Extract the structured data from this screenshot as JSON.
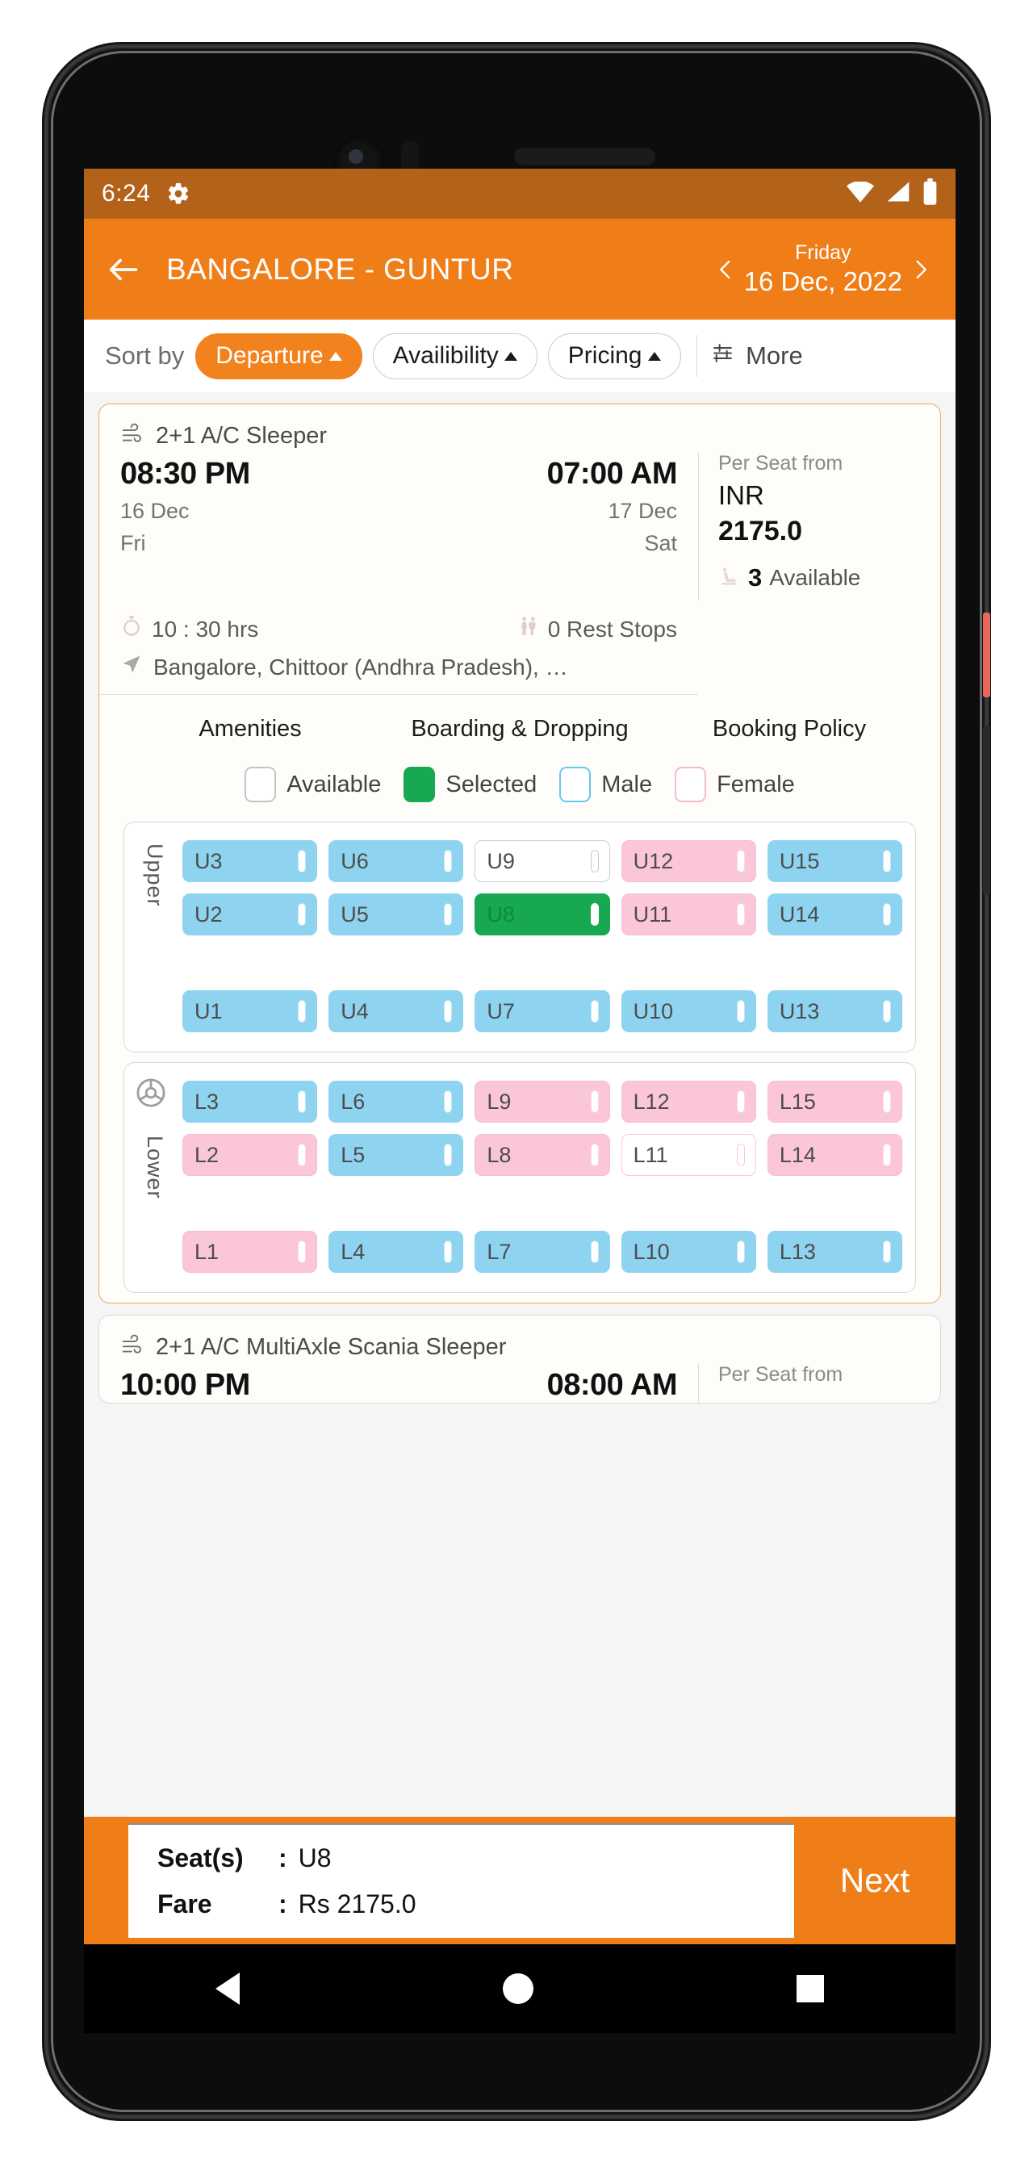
{
  "status_bar": {
    "time": "6:24",
    "icons": [
      "gear-icon",
      "wifi-icon",
      "signal-icon",
      "battery-icon"
    ]
  },
  "app_bar": {
    "back_icon": "arrow-left-icon",
    "route_title": "BANGALORE - GUNTUR",
    "day_name": "Friday",
    "date_value": "16 Dec, 2022",
    "prev_icon": "chevron-left-icon",
    "next_icon": "chevron-right-icon",
    "accent": "#f07e18"
  },
  "sort_bar": {
    "label": "Sort by",
    "chips": [
      {
        "label": "Departure",
        "active": true
      },
      {
        "label": "Availibility",
        "active": false
      },
      {
        "label": "Pricing",
        "active": false
      }
    ],
    "more_label": "More",
    "more_icon": "filter-sliders-icon"
  },
  "bus_card": {
    "bus_type": "2+1 A/C Sleeper",
    "bus_type_icon": "ac-wind-icon",
    "departure_time": "08:30 PM",
    "departure_date": "16 Dec",
    "departure_day": "Fri",
    "arrival_time": "07:00 AM",
    "arrival_date": "17 Dec",
    "arrival_day": "Sat",
    "per_seat_label": "Per Seat from",
    "currency": "INR",
    "price": "2175.0",
    "seats_available_count": "3",
    "seats_available_label": "Available",
    "seat-availability-icon": "seat-icon",
    "duration": "10 : 30 hrs",
    "duration_icon": "stopwatch-icon",
    "rest_stops": "0 Rest Stops",
    "rest_stops_icon": "restroom-icon",
    "route": "Bangalore, Chittoor (Andhra Pradesh), …",
    "route_icon": "navigation-arrow-icon",
    "tabs": [
      "Amenities",
      "Boarding & Dropping",
      "Booking Policy"
    ]
  },
  "legend": [
    {
      "label": "Available",
      "state": "available"
    },
    {
      "label": "Selected",
      "state": "selected"
    },
    {
      "label": "Male",
      "state": "male"
    },
    {
      "label": "Female",
      "state": "female"
    }
  ],
  "decks": [
    {
      "name": "Upper",
      "steering": false,
      "rows": [
        [
          {
            "id": "U3",
            "state": "male"
          },
          {
            "id": "U6",
            "state": "male"
          },
          {
            "id": "U9",
            "state": "available"
          },
          {
            "id": "U12",
            "state": "female"
          },
          {
            "id": "U15",
            "state": "male"
          }
        ],
        [
          {
            "id": "U2",
            "state": "male"
          },
          {
            "id": "U5",
            "state": "male"
          },
          {
            "id": "U8",
            "state": "selected"
          },
          {
            "id": "U11",
            "state": "female"
          },
          {
            "id": "U14",
            "state": "male"
          }
        ],
        [
          {
            "id": "U1",
            "state": "male"
          },
          {
            "id": "U4",
            "state": "male"
          },
          {
            "id": "U7",
            "state": "male"
          },
          {
            "id": "U10",
            "state": "male"
          },
          {
            "id": "U13",
            "state": "male"
          }
        ]
      ]
    },
    {
      "name": "Lower",
      "steering": true,
      "rows": [
        [
          {
            "id": "L3",
            "state": "male"
          },
          {
            "id": "L6",
            "state": "male"
          },
          {
            "id": "L9",
            "state": "female"
          },
          {
            "id": "L12",
            "state": "female"
          },
          {
            "id": "L15",
            "state": "female"
          }
        ],
        [
          {
            "id": "L2",
            "state": "female"
          },
          {
            "id": "L5",
            "state": "male"
          },
          {
            "id": "L8",
            "state": "female"
          },
          {
            "id": "L11",
            "state": "available-f"
          },
          {
            "id": "L14",
            "state": "female"
          }
        ],
        [
          {
            "id": "L1",
            "state": "female"
          },
          {
            "id": "L4",
            "state": "male"
          },
          {
            "id": "L7",
            "state": "male"
          },
          {
            "id": "L10",
            "state": "male"
          },
          {
            "id": "L13",
            "state": "male"
          }
        ]
      ]
    }
  ],
  "second_card": {
    "bus_type": "2+1 A/C MultiAxle Scania Sleeper",
    "bus_type_icon": "ac-wind-icon",
    "departure_time": "10:00 PM",
    "arrival_time": "08:00 AM",
    "per_seat_label": "Per Seat from"
  },
  "bottom_bar": {
    "seats_key": "Seat(s)",
    "seats_value": "U8",
    "fare_key": "Fare",
    "fare_value": "Rs 2175.0",
    "colon": ":",
    "next_label": "Next"
  },
  "nav_bar": {
    "back": "nav-back-icon",
    "home": "nav-home-icon",
    "recent": "nav-recent-icon"
  }
}
